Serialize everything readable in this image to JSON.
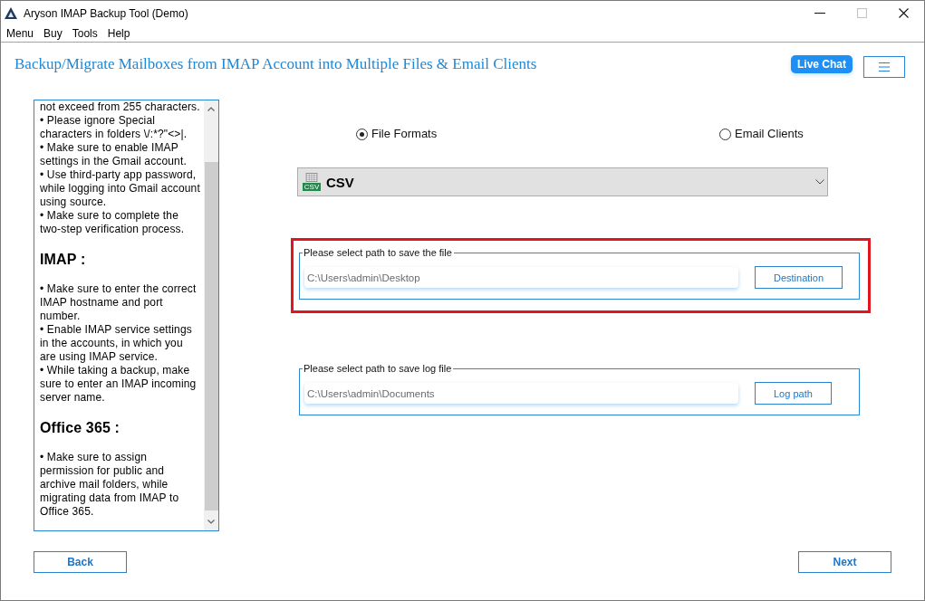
{
  "window": {
    "title": "Aryson IMAP Backup Tool (Demo)"
  },
  "menu_bar": [
    "Menu",
    "Buy",
    "Tools",
    "Help"
  ],
  "header": {
    "title": "Backup/Migrate Mailboxes from IMAP Account into Multiple Files & Email Clients",
    "live_chat": "Live Chat"
  },
  "help_panel": {
    "sections": [
      {
        "items": [
          "not exceed from 255 characters.",
          "• Please ignore Special characters in folders \\/:*?\"<>|.",
          "• Make sure to enable IMAP settings in the Gmail account.",
          "• Use third-party app password, while logging into Gmail account using source.",
          "• Make sure to complete the two-step verification process."
        ]
      },
      {
        "heading": "IMAP :",
        "items": [
          "• Make sure to enter the correct IMAP hostname and port number.",
          "• Enable IMAP service settings in the accounts, in which you are using IMAP service.",
          "• While taking a backup, make sure to enter an IMAP incoming server name."
        ]
      },
      {
        "heading": "Office 365 :",
        "items": [
          "• Make sure to assign permission for public and archive mail folders, while migrating data from IMAP to Office 365."
        ]
      }
    ]
  },
  "output_type": [
    {
      "label": "File Formats",
      "selected": true
    },
    {
      "label": "Email Clients",
      "selected": false
    }
  ],
  "format_dropdown": {
    "icon_tag": "CSV",
    "value": "CSV"
  },
  "path_groups": [
    {
      "legend": "Please select path to save the file",
      "value": "C:\\Users\\admin\\Desktop",
      "button": "Destination",
      "highlighted": true
    },
    {
      "legend": "Please select path to save log file",
      "value": "C:\\Users\\admin\\Documents",
      "button": "Log path",
      "highlighted": false
    }
  ],
  "buttons": {
    "back": "Back",
    "next": "Next"
  }
}
